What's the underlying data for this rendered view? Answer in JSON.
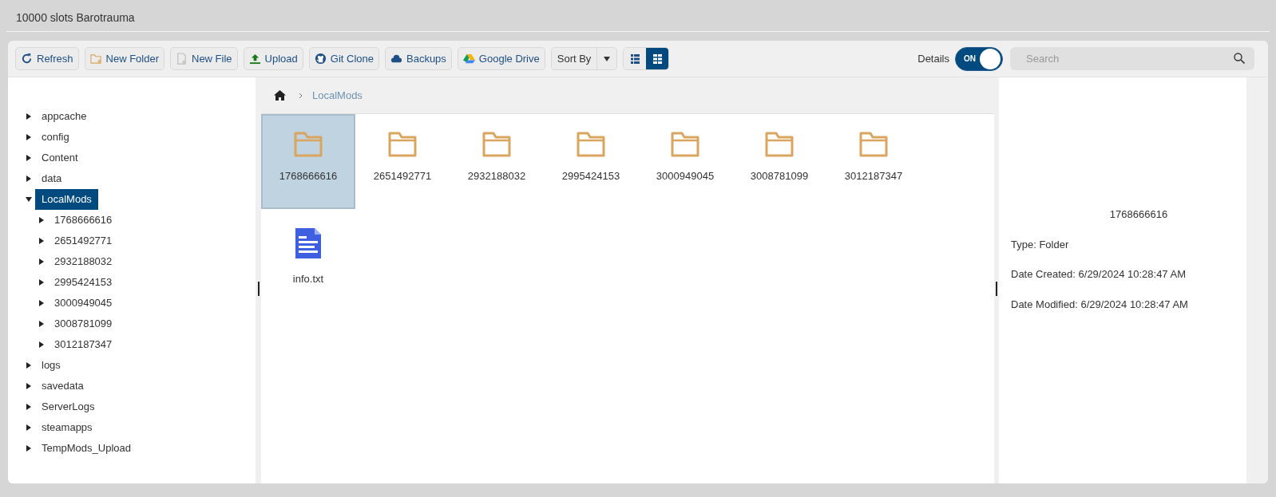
{
  "header": {
    "title": "10000 slots Barotrauma"
  },
  "toolbar": {
    "buttons": [
      {
        "label": "Refresh",
        "kind": "refresh"
      },
      {
        "label": "New Folder",
        "kind": "new-folder"
      },
      {
        "label": "New File",
        "kind": "new-file"
      },
      {
        "label": "Upload",
        "kind": "upload"
      },
      {
        "label": "Git Clone",
        "kind": "git"
      },
      {
        "label": "Backups",
        "kind": "cloud"
      },
      {
        "label": "Google Drive",
        "kind": "drive"
      }
    ],
    "sort": {
      "label": "Sort By"
    },
    "views": [
      {
        "kind": "list",
        "selected": false
      },
      {
        "kind": "grid",
        "selected": true
      }
    ],
    "details_toggle": {
      "label": "Details",
      "state_text": "ON",
      "on": true
    },
    "search": {
      "placeholder": "Search"
    }
  },
  "tree": [
    {
      "label": "appcache",
      "expanded": false,
      "selected": false
    },
    {
      "label": "config",
      "expanded": false,
      "selected": false
    },
    {
      "label": "Content",
      "expanded": false,
      "selected": false
    },
    {
      "label": "data",
      "expanded": false,
      "selected": false
    },
    {
      "label": "LocalMods",
      "expanded": true,
      "selected": true,
      "children": [
        {
          "label": "1768666616",
          "expanded": false,
          "selected": false
        },
        {
          "label": "2651492771",
          "expanded": false,
          "selected": false
        },
        {
          "label": "2932188032",
          "expanded": false,
          "selected": false
        },
        {
          "label": "2995424153",
          "expanded": false,
          "selected": false
        },
        {
          "label": "3000949045",
          "expanded": false,
          "selected": false
        },
        {
          "label": "3008781099",
          "expanded": false,
          "selected": false
        },
        {
          "label": "3012187347",
          "expanded": false,
          "selected": false
        }
      ]
    },
    {
      "label": "logs",
      "expanded": false,
      "selected": false
    },
    {
      "label": "savedata",
      "expanded": false,
      "selected": false
    },
    {
      "label": "ServerLogs",
      "expanded": false,
      "selected": false
    },
    {
      "label": "steamapps",
      "expanded": false,
      "selected": false
    },
    {
      "label": "TempMods_Upload",
      "expanded": false,
      "selected": false
    }
  ],
  "breadcrumb": [
    "LocalMods"
  ],
  "files": [
    {
      "name": "1768666616",
      "kind": "folder",
      "selected": true
    },
    {
      "name": "2651492771",
      "kind": "folder",
      "selected": false
    },
    {
      "name": "2932188032",
      "kind": "folder",
      "selected": false
    },
    {
      "name": "2995424153",
      "kind": "folder",
      "selected": false
    },
    {
      "name": "3000949045",
      "kind": "folder",
      "selected": false
    },
    {
      "name": "3008781099",
      "kind": "folder",
      "selected": false
    },
    {
      "name": "3012187347",
      "kind": "folder",
      "selected": false
    },
    {
      "name": "info.txt",
      "kind": "file",
      "selected": false
    }
  ],
  "details": {
    "name": "1768666616",
    "lines": [
      "Type: Folder",
      "Date Created: 6/29/2024 10:28:47 AM",
      "Date Modified: 6/29/2024 10:28:47 AM"
    ]
  }
}
